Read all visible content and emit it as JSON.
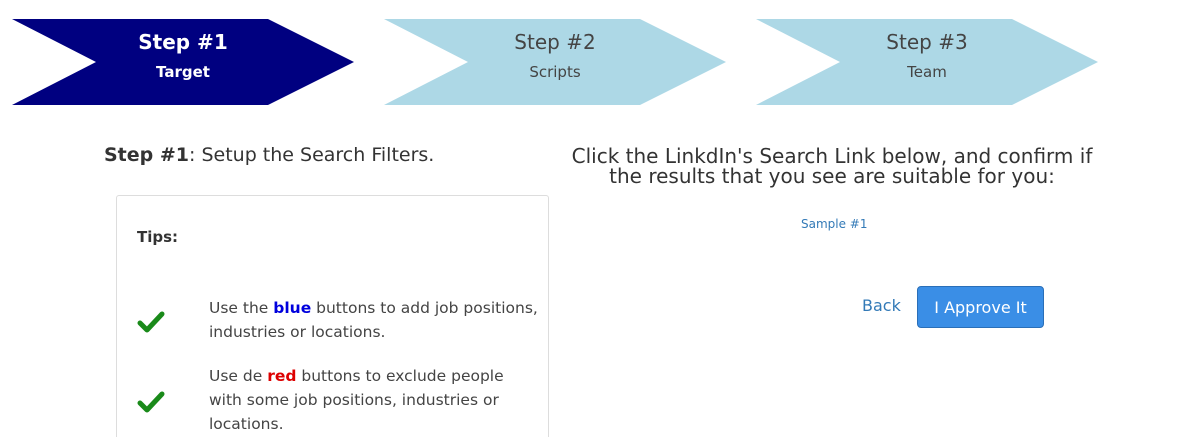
{
  "stepper": {
    "steps": [
      {
        "title": "Step #1",
        "subtitle": "Target",
        "active": true
      },
      {
        "title": "Step #2",
        "subtitle": "Scripts",
        "active": false
      },
      {
        "title": "Step #3",
        "subtitle": "Team",
        "active": false
      }
    ],
    "colors": {
      "active": "#000080",
      "inactive": "#add8e6"
    }
  },
  "left": {
    "heading_bold": "Step #1",
    "heading_rest": ": Setup the Search Filters.",
    "tips": {
      "title": "Tips:",
      "items": [
        {
          "pre": "Use the ",
          "highlight": "blue",
          "post": " buttons to add job positions, industries or locations.",
          "highlight_color": "#0000dd"
        },
        {
          "pre": "Use de ",
          "highlight": "red",
          "post": " buttons to exclude people with some job positions, industries or locations.",
          "highlight_color": "#dd0000"
        }
      ],
      "check_icon": "check-icon",
      "check_color": "#1a8a1a"
    }
  },
  "right": {
    "heading_line1": "Click the LinkdIn's Search Link below, and confirm if",
    "heading_line2": "the results that you see are suitable for you:",
    "sample_link": "Sample #1",
    "back_label": "Back",
    "approve_label": "I Approve It"
  }
}
